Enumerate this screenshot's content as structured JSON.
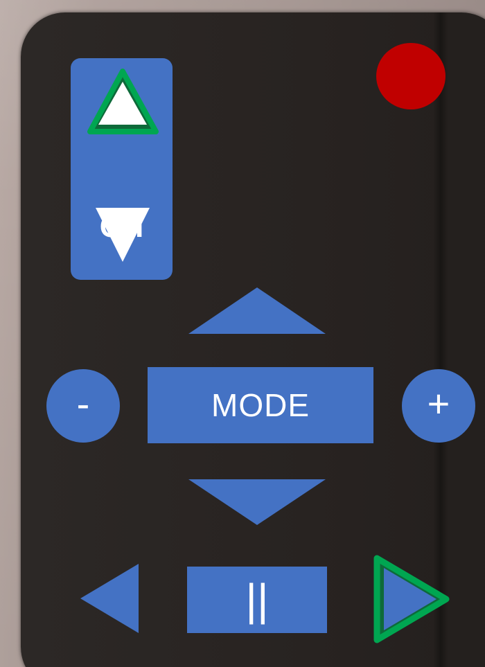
{
  "remote": {
    "channel_label": "CH",
    "mode_label": "MODE",
    "volume_down_label": "-",
    "volume_up_label": "+",
    "pause_label": "||"
  },
  "colors": {
    "body": "#282321",
    "button_blue": "#4472c4",
    "power_red": "#c00000",
    "highlight_green": "#00a651"
  },
  "icons": {
    "channel_up": "triangle-up-icon",
    "channel_down": "triangle-down-icon",
    "nav_up": "triangle-up-icon",
    "nav_down": "triangle-down-icon",
    "rewind": "triangle-left-icon",
    "play": "triangle-right-icon",
    "power": "circle-icon"
  },
  "highlighted_buttons": [
    "channel-up-button",
    "play-button"
  ]
}
